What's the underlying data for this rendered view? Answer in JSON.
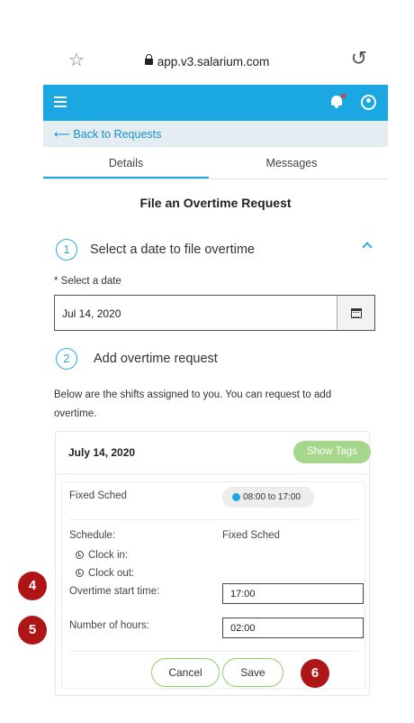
{
  "browser": {
    "url": "app.v3.salarium.com"
  },
  "nav": {
    "back_label": "Back to Requests"
  },
  "tabs": [
    {
      "label": "Details"
    },
    {
      "label": "Messages"
    }
  ],
  "page": {
    "title": "File an Overtime Request"
  },
  "step1": {
    "number": "1",
    "title": "Select a date to file overtime",
    "date_label": "* Select a date",
    "date_value": "Jul 14, 2020"
  },
  "step2": {
    "number": "2",
    "title": "Add overtime request",
    "info": "Below are the shifts assigned to you. You can request to add overtime."
  },
  "card": {
    "date": "July 14, 2020",
    "show_tags_label": "Show Tags",
    "schedule_name": "Fixed Sched",
    "shift_time": "08:00 to 17:00",
    "schedule_label": "Schedule:",
    "schedule_value": "Fixed Sched",
    "clock_in_label": "Clock in:",
    "clock_out_label": "Clock out:",
    "ot_start_label": "Overtime start time:",
    "ot_start_value": "17:00",
    "hours_label": "Number of hours:",
    "hours_value": "02:00",
    "cancel_label": "Cancel",
    "save_label": "Save"
  },
  "markers": {
    "m4": "4",
    "m5": "5",
    "m6": "6"
  },
  "colors": {
    "primary": "#1ba7e1",
    "success": "#8fcf6f",
    "marker": "#b01515",
    "back_bar": "#e3edf2"
  }
}
